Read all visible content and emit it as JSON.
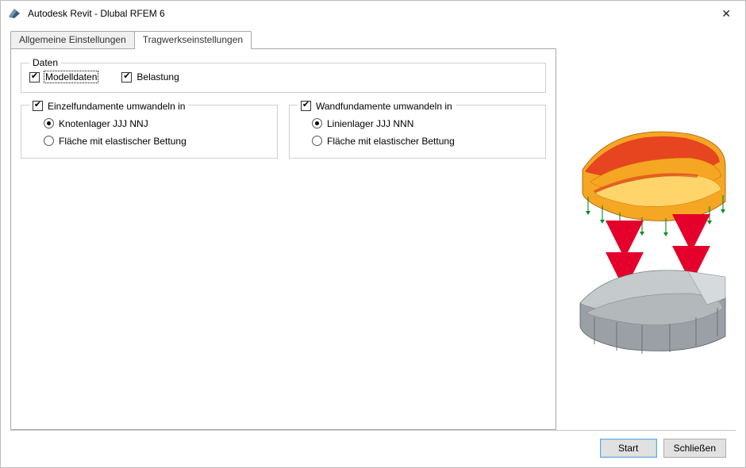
{
  "window": {
    "title": "Autodesk Revit - Dlubal RFEM 6"
  },
  "tabs": {
    "general": {
      "label": "Allgemeine Einstellungen"
    },
    "structural": {
      "label": "Tragwerkseinstellungen"
    }
  },
  "page": {
    "data_group": {
      "legend": "Daten",
      "model_data": {
        "label": "Modelldaten",
        "checked": true,
        "focused": true
      },
      "loading": {
        "label": "Belastung",
        "checked": true
      }
    },
    "single_foundations": {
      "legend": "Einzelfundamente umwandeln in",
      "checked": true,
      "options": {
        "nodal": {
          "label": "Knotenlager JJJ NNJ",
          "selected": true
        },
        "surface": {
          "label": "Fläche mit elastischer Bettung",
          "selected": false
        }
      }
    },
    "wall_foundations": {
      "legend": "Wandfundamente umwandeln in",
      "checked": true,
      "options": {
        "linear": {
          "label": "Linienlager JJJ NNN",
          "selected": true
        },
        "surface": {
          "label": "Fläche mit elastischer Bettung",
          "selected": false
        }
      }
    }
  },
  "footer": {
    "start": "Start",
    "close": "Schließen"
  },
  "illustration": {
    "top_desc": "analysis-model-colored",
    "bottom_desc": "revit-model-grey",
    "arrow_desc": "bidirectional-sync-arrows"
  }
}
